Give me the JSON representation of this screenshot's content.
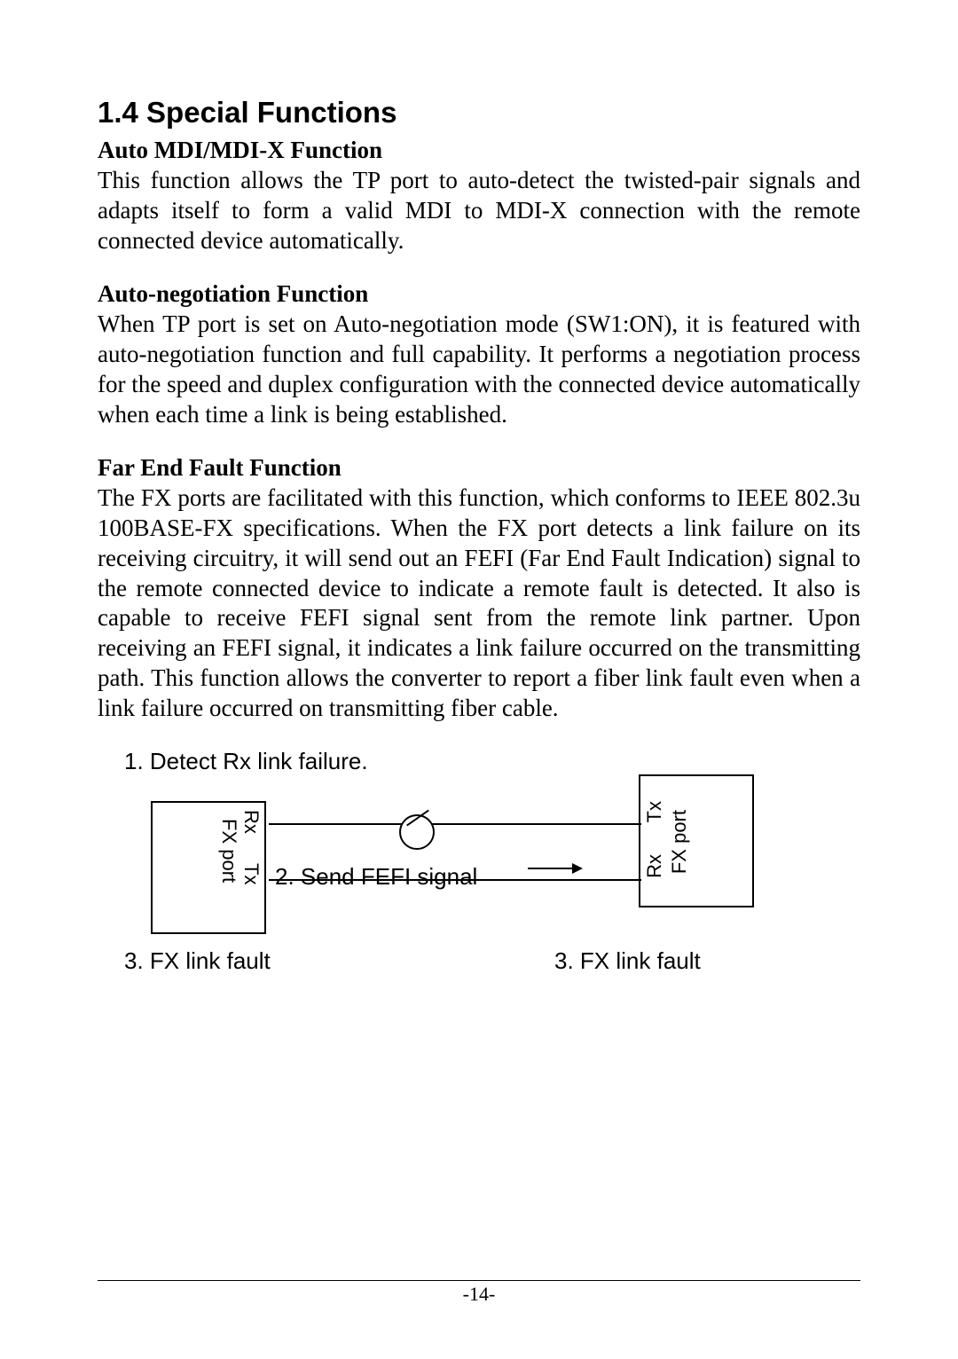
{
  "section": {
    "heading": "1.4 Special Functions",
    "subsections": [
      {
        "title": "Auto MDI/MDI-X Function",
        "body": "This function allows the TP port to auto-detect the twisted-pair signals and adapts itself to form a valid MDI to MDI-X connection with the remote connected device automatically."
      },
      {
        "title": "Auto-negotiation Function",
        "body": "When TP port is set on Auto-negotiation mode (SW1:ON), it is featured with auto-negotiation function and full capability. It performs a negotiation process for the speed and duplex configuration with the connected device automatically when each time a link is being established."
      },
      {
        "title": "Far End Fault Function",
        "body": "The FX ports are facilitated with this function, which conforms to IEEE 802.3u 100BASE-FX specifications. When the FX port detects a link failure on its receiving circuitry, it will send out an FEFI (Far End Fault Indication) signal to the remote connected device to indicate a remote fault is detected. It also is capable to receive FEFI signal sent from the remote link partner. Upon receiving an FEFI signal, it indicates a link failure occurred on the transmitting path. This function allows the converter to report a fiber link fault even when a link failure occurred on transmitting fiber cable."
      }
    ]
  },
  "diagram": {
    "step1": "1. Detect Rx link failure.",
    "step2": "2. Send FEFI signal",
    "step3_left": "3. FX link fault",
    "step3_right": "3. FX link fault",
    "rx": "Rx",
    "tx": "Tx",
    "fxport": "FX port"
  },
  "page_number": "-14-"
}
